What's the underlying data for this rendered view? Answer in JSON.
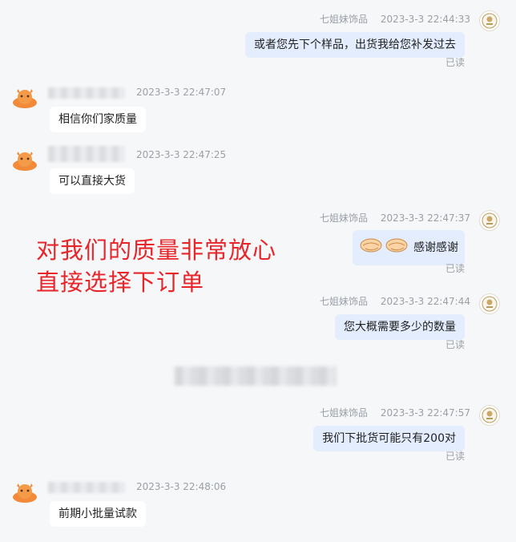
{
  "shop_name": "七姐妹饰品",
  "read_label": "已读",
  "messages": [
    {
      "time": "2023-3-3 22:44:33",
      "text": "或者您先下个样品，出货我给您补发过去"
    },
    {
      "time": "2023-3-3 22:47:07",
      "text": "相信你们家质量"
    },
    {
      "time": "2023-3-3 22:47:25",
      "text": "可以直接大货"
    },
    {
      "time": "2023-3-3 22:47:37",
      "text": "感谢感谢",
      "emoji": "handshake-icon"
    },
    {
      "time": "2023-3-3 22:47:44",
      "text": "您大概需要多少的数量"
    },
    {
      "time": "2023-3-3 22:47:57",
      "text": "我们下批货可能只有200对"
    },
    {
      "time": "2023-3-3 22:48:06",
      "text": "前期小批量试款"
    }
  ],
  "annotation": {
    "line1": "对我们的质量非常放心",
    "line2": "直接选择下订单",
    "color": "#e8262a"
  },
  "colors": {
    "outgoing_bubble": "#e3edfd",
    "incoming_bubble": "#ffffff",
    "background": "#f6f7f9"
  }
}
